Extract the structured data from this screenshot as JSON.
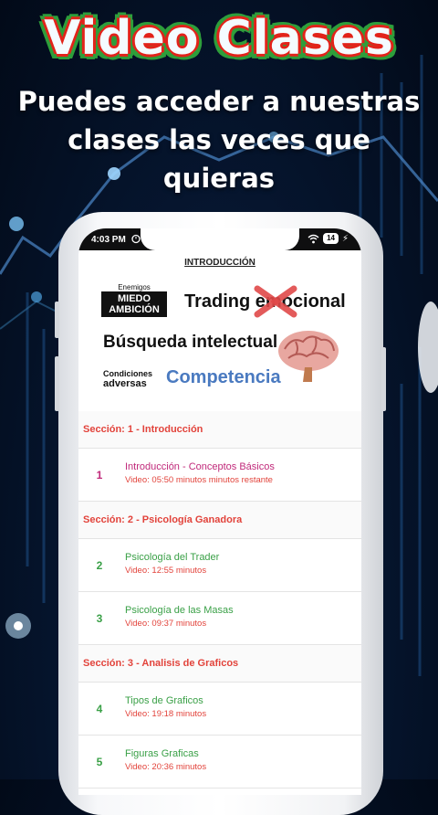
{
  "promo": {
    "title": "Video Clases",
    "subtitle_lines": [
      "Puedes acceder a nuestras",
      "clases las veces que",
      "quieras"
    ]
  },
  "status_bar": {
    "time": "4:03 PM",
    "battery": "14"
  },
  "video_preview": {
    "label": "INTRODUCCIÓN",
    "enemigos": "Enemigos",
    "miedo": "MIEDO",
    "ambicion": "AMBICIÓN",
    "trading": "Trading emocional",
    "busqueda": "Búsqueda intelectual",
    "condiciones": "Condiciones",
    "adversas": "adversas",
    "competencia": "Competencia"
  },
  "course": {
    "sections": [
      {
        "title": "Sección: 1 - Introducción",
        "items": [
          {
            "num": "1",
            "title": "Introducción - Conceptos Básicos",
            "duration": "Video: 05:50 minutos minutos restante",
            "active": true
          }
        ]
      },
      {
        "title": "Sección: 2 - Psicología Ganadora",
        "items": [
          {
            "num": "2",
            "title": "Psicología del Trader",
            "duration": "Video: 12:55 minutos"
          },
          {
            "num": "3",
            "title": "Psicología de las Masas",
            "duration": "Video: 09:37 minutos"
          }
        ]
      },
      {
        "title": "Sección: 3 - Analisis de Graficos",
        "items": [
          {
            "num": "4",
            "title": "Tipos de Graficos",
            "duration": "Video: 19:18 minutos"
          },
          {
            "num": "5",
            "title": "Figuras Graficas",
            "duration": "Video: 20:36 minutos"
          }
        ]
      }
    ]
  },
  "colors": {
    "section_title": "#e2433b",
    "active_item": "#c0297a",
    "item": "#3aa047",
    "accent_red": "#e2231a",
    "accent_green": "#2e9e3b"
  }
}
